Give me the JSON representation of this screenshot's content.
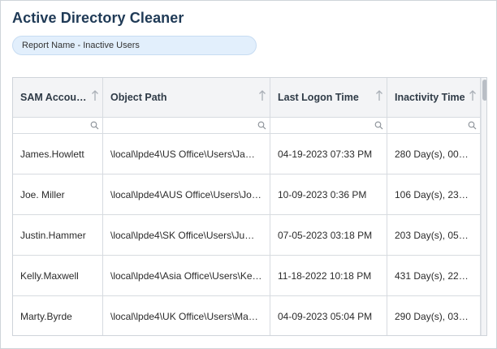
{
  "app": {
    "title": "Active Directory Cleaner",
    "report_label": "Report Name - Inactive Users"
  },
  "columns": [
    {
      "label": "SAM Accou…",
      "icon": "sort-arrow-up-icon"
    },
    {
      "label": "Object Path",
      "icon": "sort-arrow-up-icon"
    },
    {
      "label": "Last Logon Time",
      "icon": "sort-arrow-up-icon"
    },
    {
      "label": "Inactivity Time",
      "icon": "sort-arrow-up-icon"
    }
  ],
  "rows": [
    [
      "James.Howlett",
      "\\local\\lpde4\\US Office\\Users\\Ja…",
      "04-19-2023 07:33 PM",
      "280 Day(s), 00…"
    ],
    [
      "Joe. Miller",
      "\\local\\lpde4\\AUS Office\\Users\\Jo…",
      "10-09-2023 0:36 PM",
      "106 Day(s), 23…"
    ],
    [
      "Justin.Hammer",
      "\\local\\lpde4\\SK Office\\Users\\Ju…",
      "07-05-2023 03:18 PM",
      "203 Day(s), 05…"
    ],
    [
      "Kelly.Maxwell",
      "\\local\\lpde4\\Asia Office\\Users\\Ke…",
      "11-18-2022 10:18 PM",
      "431 Day(s), 22…"
    ],
    [
      "Marty.Byrde",
      "\\local\\lpde4\\UK Office\\Users\\Ma…",
      "04-09-2023 05:04 PM",
      "290 Day(s), 03…"
    ]
  ],
  "colors": {
    "title": "#1f3a56",
    "pill_bg": "#e2effc",
    "header_bg": "#f3f4f6",
    "border": "#d7dbe0"
  }
}
